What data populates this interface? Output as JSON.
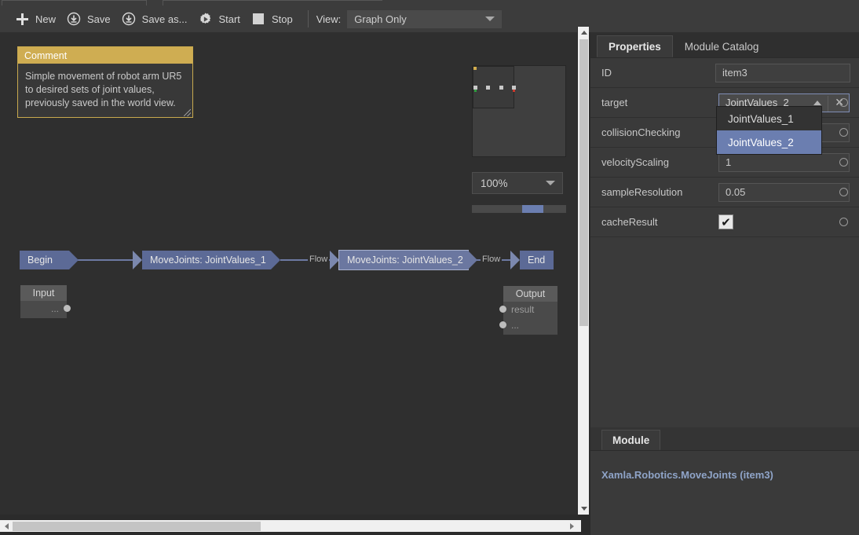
{
  "toolbar": {
    "buttons": [
      {
        "label": "New",
        "icon": "plus-icon"
      },
      {
        "label": "Save",
        "icon": "save-download-icon"
      },
      {
        "label": "Save as...",
        "icon": "save-as-download-icon"
      },
      {
        "label": "Start",
        "icon": "start-gear-play-icon"
      },
      {
        "label": "Stop",
        "icon": "stop-square-icon"
      }
    ],
    "view_label": "View:",
    "view_value": "Graph Only"
  },
  "canvas": {
    "comment": {
      "title": "Comment",
      "text": "Simple movement of robot arm UR5 to desired sets of joint values, previously saved in the world view."
    },
    "zoom": {
      "value": "100%"
    },
    "nodes": [
      {
        "label": "Begin",
        "type": "begin"
      },
      {
        "label": "MoveJoints: JointValues_1",
        "type": "module"
      },
      {
        "label": "MoveJoints: JointValues_2",
        "type": "module",
        "selected": true
      },
      {
        "label": "End",
        "type": "end"
      }
    ],
    "flow_labels": [
      "Flow",
      "Flow"
    ],
    "input_node": {
      "title": "Input",
      "ports": [
        "..."
      ]
    },
    "output_node": {
      "title": "Output",
      "ports": [
        "result",
        "..."
      ]
    }
  },
  "panel": {
    "tabs": [
      {
        "label": "Properties",
        "active": true
      },
      {
        "label": "Module Catalog",
        "active": false
      }
    ],
    "properties": [
      {
        "name": "ID",
        "value": "item3",
        "kind": "text"
      },
      {
        "name": "target",
        "value": "JointValues_2",
        "kind": "combo"
      },
      {
        "name": "collisionChecking",
        "value": "",
        "kind": "text"
      },
      {
        "name": "velocityScaling",
        "value": "1",
        "kind": "text"
      },
      {
        "name": "sampleResolution",
        "value": "0.05",
        "kind": "text"
      },
      {
        "name": "cacheResult",
        "value": "true",
        "kind": "checkbox"
      }
    ],
    "dropdown": {
      "options": [
        {
          "label": "JointValues_1",
          "selected": false
        },
        {
          "label": "JointValues_2",
          "selected": true
        }
      ]
    },
    "module": {
      "tab_label": "Module",
      "text": "Xamla.Robotics.MoveJoints (item3)"
    }
  },
  "colors": {
    "accent": "#6b7eb0",
    "node": "#5c6a96",
    "comment": "#cfad52",
    "panel_bg": "#3a3a3a"
  }
}
